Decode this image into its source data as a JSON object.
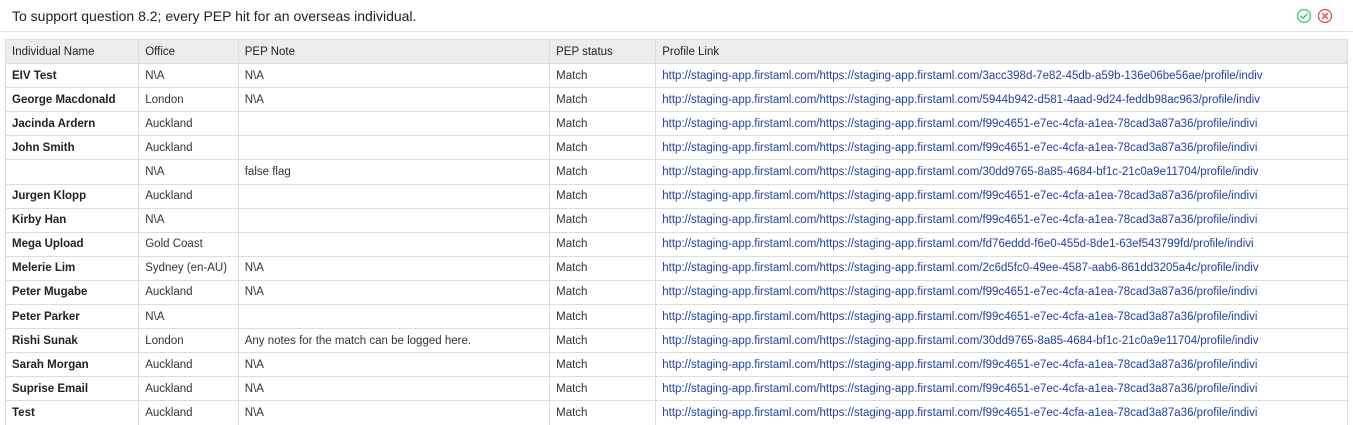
{
  "header": {
    "title": "To support question 8.2; every PEP hit for an overseas individual.",
    "accept_icon": "check-circle-icon",
    "reject_icon": "x-circle-icon",
    "accept_color": "#2ecc71",
    "reject_color": "#e74c3c"
  },
  "table": {
    "columns": [
      "Individual Name",
      "Office",
      "PEP Note",
      "PEP status",
      "Profile Link"
    ],
    "rows": [
      {
        "name": "EIV Test",
        "office": "N\\A",
        "note": "N\\A",
        "status": "Match",
        "link": "http://staging-app.firstaml.com/https://staging-app.firstaml.com/3acc398d-7e82-45db-a59b-136e06be56ae/profile/indiv"
      },
      {
        "name": "George Macdonald",
        "office": "London",
        "note": "N\\A",
        "status": "Match",
        "link": "http://staging-app.firstaml.com/https://staging-app.firstaml.com/5944b942-d581-4aad-9d24-feddb98ac963/profile/indiv"
      },
      {
        "name": "Jacinda Ardern",
        "office": "Auckland",
        "note": "",
        "status": "Match",
        "link": "http://staging-app.firstaml.com/https://staging-app.firstaml.com/f99c4651-e7ec-4cfa-a1ea-78cad3a87a36/profile/indivi"
      },
      {
        "name": "John Smith",
        "office": "Auckland",
        "note": "",
        "status": "Match",
        "link": "http://staging-app.firstaml.com/https://staging-app.firstaml.com/f99c4651-e7ec-4cfa-a1ea-78cad3a87a36/profile/indivi"
      },
      {
        "name": "",
        "office": "N\\A",
        "note": "false flag",
        "status": "Match",
        "link": "http://staging-app.firstaml.com/https://staging-app.firstaml.com/30dd9765-8a85-4684-bf1c-21c0a9e11704/profile/indiv"
      },
      {
        "name": "Jurgen Klopp",
        "office": "Auckland",
        "note": "",
        "status": "Match",
        "link": "http://staging-app.firstaml.com/https://staging-app.firstaml.com/f99c4651-e7ec-4cfa-a1ea-78cad3a87a36/profile/indivi"
      },
      {
        "name": "Kirby Han",
        "office": "N\\A",
        "note": "",
        "status": "Match",
        "link": "http://staging-app.firstaml.com/https://staging-app.firstaml.com/f99c4651-e7ec-4cfa-a1ea-78cad3a87a36/profile/indivi"
      },
      {
        "name": "Mega Upload",
        "office": "Gold Coast",
        "note": "",
        "status": "Match",
        "link": "http://staging-app.firstaml.com/https://staging-app.firstaml.com/fd76eddd-f6e0-455d-8de1-63ef543799fd/profile/indivi"
      },
      {
        "name": "Melerie Lim",
        "office": "Sydney (en-AU)",
        "note": "N\\A",
        "status": "Match",
        "link": "http://staging-app.firstaml.com/https://staging-app.firstaml.com/2c6d5fc0-49ee-4587-aab6-861dd3205a4c/profile/indiv"
      },
      {
        "name": "Peter Mugabe",
        "office": "Auckland",
        "note": "N\\A",
        "status": "Match",
        "link": "http://staging-app.firstaml.com/https://staging-app.firstaml.com/f99c4651-e7ec-4cfa-a1ea-78cad3a87a36/profile/indivi"
      },
      {
        "name": "Peter Parker",
        "office": "N\\A",
        "note": "",
        "status": "Match",
        "link": "http://staging-app.firstaml.com/https://staging-app.firstaml.com/f99c4651-e7ec-4cfa-a1ea-78cad3a87a36/profile/indivi"
      },
      {
        "name": "Rishi Sunak",
        "office": "London",
        "note": "Any notes for the match can be logged here.",
        "status": "Match",
        "link": "http://staging-app.firstaml.com/https://staging-app.firstaml.com/30dd9765-8a85-4684-bf1c-21c0a9e11704/profile/indiv"
      },
      {
        "name": "Sarah Morgan",
        "office": "Auckland",
        "note": "N\\A",
        "status": "Match",
        "link": "http://staging-app.firstaml.com/https://staging-app.firstaml.com/f99c4651-e7ec-4cfa-a1ea-78cad3a87a36/profile/indivi"
      },
      {
        "name": "Suprise Email",
        "office": "Auckland",
        "note": "N\\A",
        "status": "Match",
        "link": "http://staging-app.firstaml.com/https://staging-app.firstaml.com/f99c4651-e7ec-4cfa-a1ea-78cad3a87a36/profile/indivi"
      },
      {
        "name": "Test",
        "office": "Auckland",
        "note": "N\\A",
        "status": "Match",
        "link": "http://staging-app.firstaml.com/https://staging-app.firstaml.com/f99c4651-e7ec-4cfa-a1ea-78cad3a87a36/profile/indivi"
      }
    ]
  }
}
